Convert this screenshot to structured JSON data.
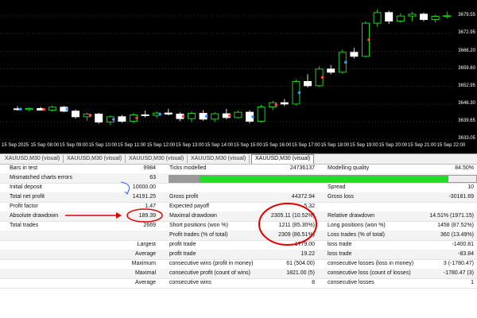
{
  "chart": {
    "background": "#000000",
    "price_ticks": [
      "3679.55",
      "3672.95",
      "3666.20",
      "3659.60",
      "3652.95",
      "3646.30",
      "3639.65",
      "3633.05"
    ],
    "time_ticks": [
      "15 Sep 2025",
      "15 Sep 08:00",
      "15 Sep 09:00",
      "15 Sep 10:00",
      "15 Sep 11:00",
      "15 Sep 12:00",
      "15 Sep 13:00",
      "15 Sep 14:00",
      "15 Sep 15:00",
      "15 Sep 16:00",
      "15 Sep 17:00",
      "15 Sep 18:00",
      "15 Sep 19:00",
      "15 Sep 20:00",
      "15 Sep 21:00",
      "15 Sep 22:00"
    ],
    "bull_color": "#22cc22",
    "bear_color": "#ffffff",
    "candles": [
      {
        "o": 3644.5,
        "h": 3645.5,
        "l": 3643.8,
        "c": 3644.2
      },
      {
        "o": 3644.2,
        "h": 3645.0,
        "l": 3643.6,
        "c": 3644.6
      },
      {
        "o": 3644.6,
        "h": 3645.2,
        "l": 3643.9,
        "c": 3644.0
      },
      {
        "o": 3644.0,
        "h": 3645.8,
        "l": 3643.5,
        "c": 3645.1
      },
      {
        "o": 3645.1,
        "h": 3645.6,
        "l": 3643.2,
        "c": 3643.6
      },
      {
        "o": 3643.6,
        "h": 3644.2,
        "l": 3640.8,
        "c": 3641.5
      },
      {
        "o": 3641.5,
        "h": 3643.0,
        "l": 3640.0,
        "c": 3642.5
      },
      {
        "o": 3642.5,
        "h": 3643.0,
        "l": 3638.8,
        "c": 3639.5
      },
      {
        "o": 3639.5,
        "h": 3642.0,
        "l": 3638.5,
        "c": 3641.5
      },
      {
        "o": 3641.5,
        "h": 3642.2,
        "l": 3639.2,
        "c": 3639.8
      },
      {
        "o": 3639.8,
        "h": 3643.0,
        "l": 3639.0,
        "c": 3642.2
      },
      {
        "o": 3642.2,
        "h": 3643.8,
        "l": 3641.2,
        "c": 3642.0
      },
      {
        "o": 3642.0,
        "h": 3643.5,
        "l": 3641.0,
        "c": 3642.9
      },
      {
        "o": 3642.9,
        "h": 3644.5,
        "l": 3642.0,
        "c": 3642.5
      },
      {
        "o": 3642.5,
        "h": 3643.2,
        "l": 3639.8,
        "c": 3640.8
      },
      {
        "o": 3640.8,
        "h": 3643.5,
        "l": 3639.5,
        "c": 3642.8
      },
      {
        "o": 3642.8,
        "h": 3644.0,
        "l": 3640.0,
        "c": 3640.6
      },
      {
        "o": 3640.6,
        "h": 3643.2,
        "l": 3639.5,
        "c": 3642.6
      },
      {
        "o": 3642.6,
        "h": 3644.5,
        "l": 3640.5,
        "c": 3641.2
      },
      {
        "o": 3641.2,
        "h": 3643.8,
        "l": 3640.8,
        "c": 3643.2
      },
      {
        "o": 3643.2,
        "h": 3644.0,
        "l": 3639.0,
        "c": 3639.8
      },
      {
        "o": 3639.8,
        "h": 3646.0,
        "l": 3639.2,
        "c": 3645.2
      },
      {
        "o": 3645.2,
        "h": 3647.5,
        "l": 3644.0,
        "c": 3646.8
      },
      {
        "o": 3646.8,
        "h": 3648.2,
        "l": 3645.5,
        "c": 3646.3
      },
      {
        "o": 3646.3,
        "h": 3655.5,
        "l": 3645.8,
        "c": 3654.8
      },
      {
        "o": 3654.8,
        "h": 3657.5,
        "l": 3652.5,
        "c": 3653.2
      },
      {
        "o": 3653.2,
        "h": 3660.5,
        "l": 3652.8,
        "c": 3659.5
      },
      {
        "o": 3659.5,
        "h": 3661.0,
        "l": 3657.5,
        "c": 3658.3
      },
      {
        "o": 3658.3,
        "h": 3666.8,
        "l": 3657.8,
        "c": 3665.8
      },
      {
        "o": 3665.8,
        "h": 3667.5,
        "l": 3663.5,
        "c": 3664.3
      },
      {
        "o": 3664.3,
        "h": 3677.5,
        "l": 3663.8,
        "c": 3676.8
      },
      {
        "o": 3676.8,
        "h": 3682.0,
        "l": 3675.5,
        "c": 3680.8
      },
      {
        "o": 3680.8,
        "h": 3681.5,
        "l": 3676.5,
        "c": 3677.6
      },
      {
        "o": 3677.6,
        "h": 3680.5,
        "l": 3677.0,
        "c": 3679.5
      },
      {
        "o": 3679.5,
        "h": 3681.0,
        "l": 3677.5,
        "c": 3680.2
      },
      {
        "o": 3680.2,
        "h": 3680.8,
        "l": 3677.5,
        "c": 3678.2
      },
      {
        "o": 3678.2,
        "h": 3680.0,
        "l": 3677.0,
        "c": 3679.4
      },
      {
        "o": 3679.4,
        "h": 3681.2,
        "l": 3678.5,
        "c": 3679.6
      }
    ]
  },
  "tabs": [
    "XAUUSD,M30 (visual)",
    "XAUUSD,M30 (visual)",
    "XAUUSD,M30 (visual)",
    "XAUUSD,M30 (visual)",
    "XAUUSD,M30 (visual)"
  ],
  "quality_fill": 0.9,
  "quality_color": "#22dd22",
  "report": {
    "r1": {
      "l1": "Bars in test",
      "v1": "9984",
      "l2": "Ticks modelled",
      "v2": "24736137",
      "l3": "Modelling quality",
      "v3": "84.50%"
    },
    "r2": {
      "l1": "Mismatched charts errors",
      "v1": "63"
    },
    "r3": {
      "l1": "Initial deposit",
      "v1": "10000.00",
      "l3": "Spread",
      "v3": "10"
    },
    "r4": {
      "l1": "Total net profit",
      "v1": "14191.25",
      "l2": "Gross profit",
      "v2": "44372.94",
      "l3": "Gross loss",
      "v3": "-30181.69"
    },
    "r5": {
      "l1": "Profit factor",
      "v1": "1.47",
      "l2": "Expected payoff",
      "v2": "5.32"
    },
    "r6": {
      "l1": "Absolute drawdown",
      "v1": "189.39",
      "l2": "Maximal drawdown",
      "v2": "2305.11 (10.52%)",
      "l3": "Relative drawdown",
      "v3": "14.51% (1971.15)"
    },
    "r7": {
      "l1": "Total trades",
      "v1": "2669",
      "l2": "Short positions (won %)",
      "v2": "1211 (85.30%)",
      "l3": "Long positions (won %)",
      "v3": "1458 (87.52%)"
    },
    "r8": {
      "l2": "Profit trades (% of total)",
      "v2": "2309 (86.51%)",
      "l3": "Loss trades (% of total)",
      "v3": "360 (13.49%)"
    },
    "r9": {
      "a": "Largest",
      "l2": "profit trade",
      "v2": "1779.00",
      "l3": "loss trade",
      "v3": "-1400.81"
    },
    "r10": {
      "a": "Average",
      "l2": "profit trade",
      "v2": "19.22",
      "l3": "loss trade",
      "v3": "-83.84"
    },
    "r11": {
      "a": "Maximum",
      "l2": "consecutive wins (profit in money)",
      "v2": "61 (504.00)",
      "l3": "consecutive losses (loss in money)",
      "v3": "3 (-1780.47)"
    },
    "r12": {
      "a": "Maximal",
      "l2": "consecutive profit (count of wins)",
      "v2": "1821.00 (5)",
      "l3": "consecutive loss (count of losses)",
      "v3": "-1780.47 (3)"
    },
    "r13": {
      "a": "Average",
      "l2": "consecutive wins",
      "v2": "8",
      "l3": "consecutive losses",
      "v3": "1"
    }
  },
  "annotation_color": "#e00000"
}
